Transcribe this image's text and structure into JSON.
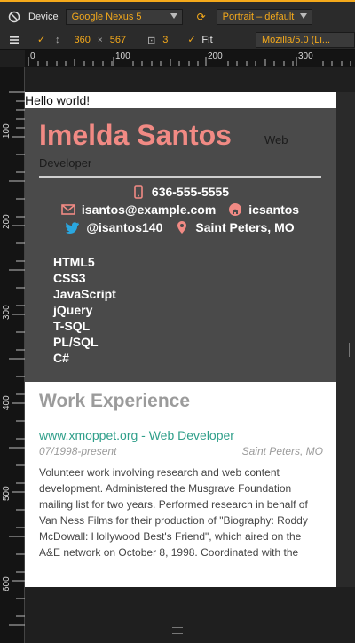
{
  "toolbar": {
    "device_label": "Device",
    "device_value": "Google Nexus 5",
    "orientation_value": "Portrait – default",
    "width": "360",
    "height": "567",
    "times_symbol": "×",
    "scale": "3",
    "fit_label": "Fit",
    "user_agent": "Mozilla/5.0 (Li..."
  },
  "ruler_top": {
    "labels": [
      "0",
      "100",
      "200",
      "300"
    ]
  },
  "ruler_left": {
    "labels": [
      "100",
      "200",
      "300",
      "400",
      "500",
      "600"
    ]
  },
  "page": {
    "hello": "Hello world!",
    "name": "Imelda Santos",
    "role": "Web Developer",
    "phone": "636-555-5555",
    "email": "isantos@example.com",
    "github": "icsantos",
    "twitter": "@isantos140",
    "location": "Saint Peters, MO",
    "skills": [
      "HTML5",
      "CSS3",
      "JavaScript",
      "jQuery",
      "T-SQL",
      "PL/SQL",
      "C#"
    ],
    "work_title": "Work Experience",
    "job_title": "www.xmoppet.org - Web Developer",
    "job_dates": "07/1998-present",
    "job_location": "Saint Peters, MO",
    "job_description": "Volunteer work involving research and web content development. Administered the Musgrave Foundation mailing list for two years. Performed research in behalf of Van Ness Films for their production of \"Biography: Roddy McDowall: Hollywood Best's Friend\", which aired on the A&E network on October 8, 1998. Coordinated with the"
  },
  "colors": {
    "accent": "#f4a91b",
    "name": "#f18a84",
    "link": "#2f9f8a",
    "twitter": "#2aa7e0"
  }
}
